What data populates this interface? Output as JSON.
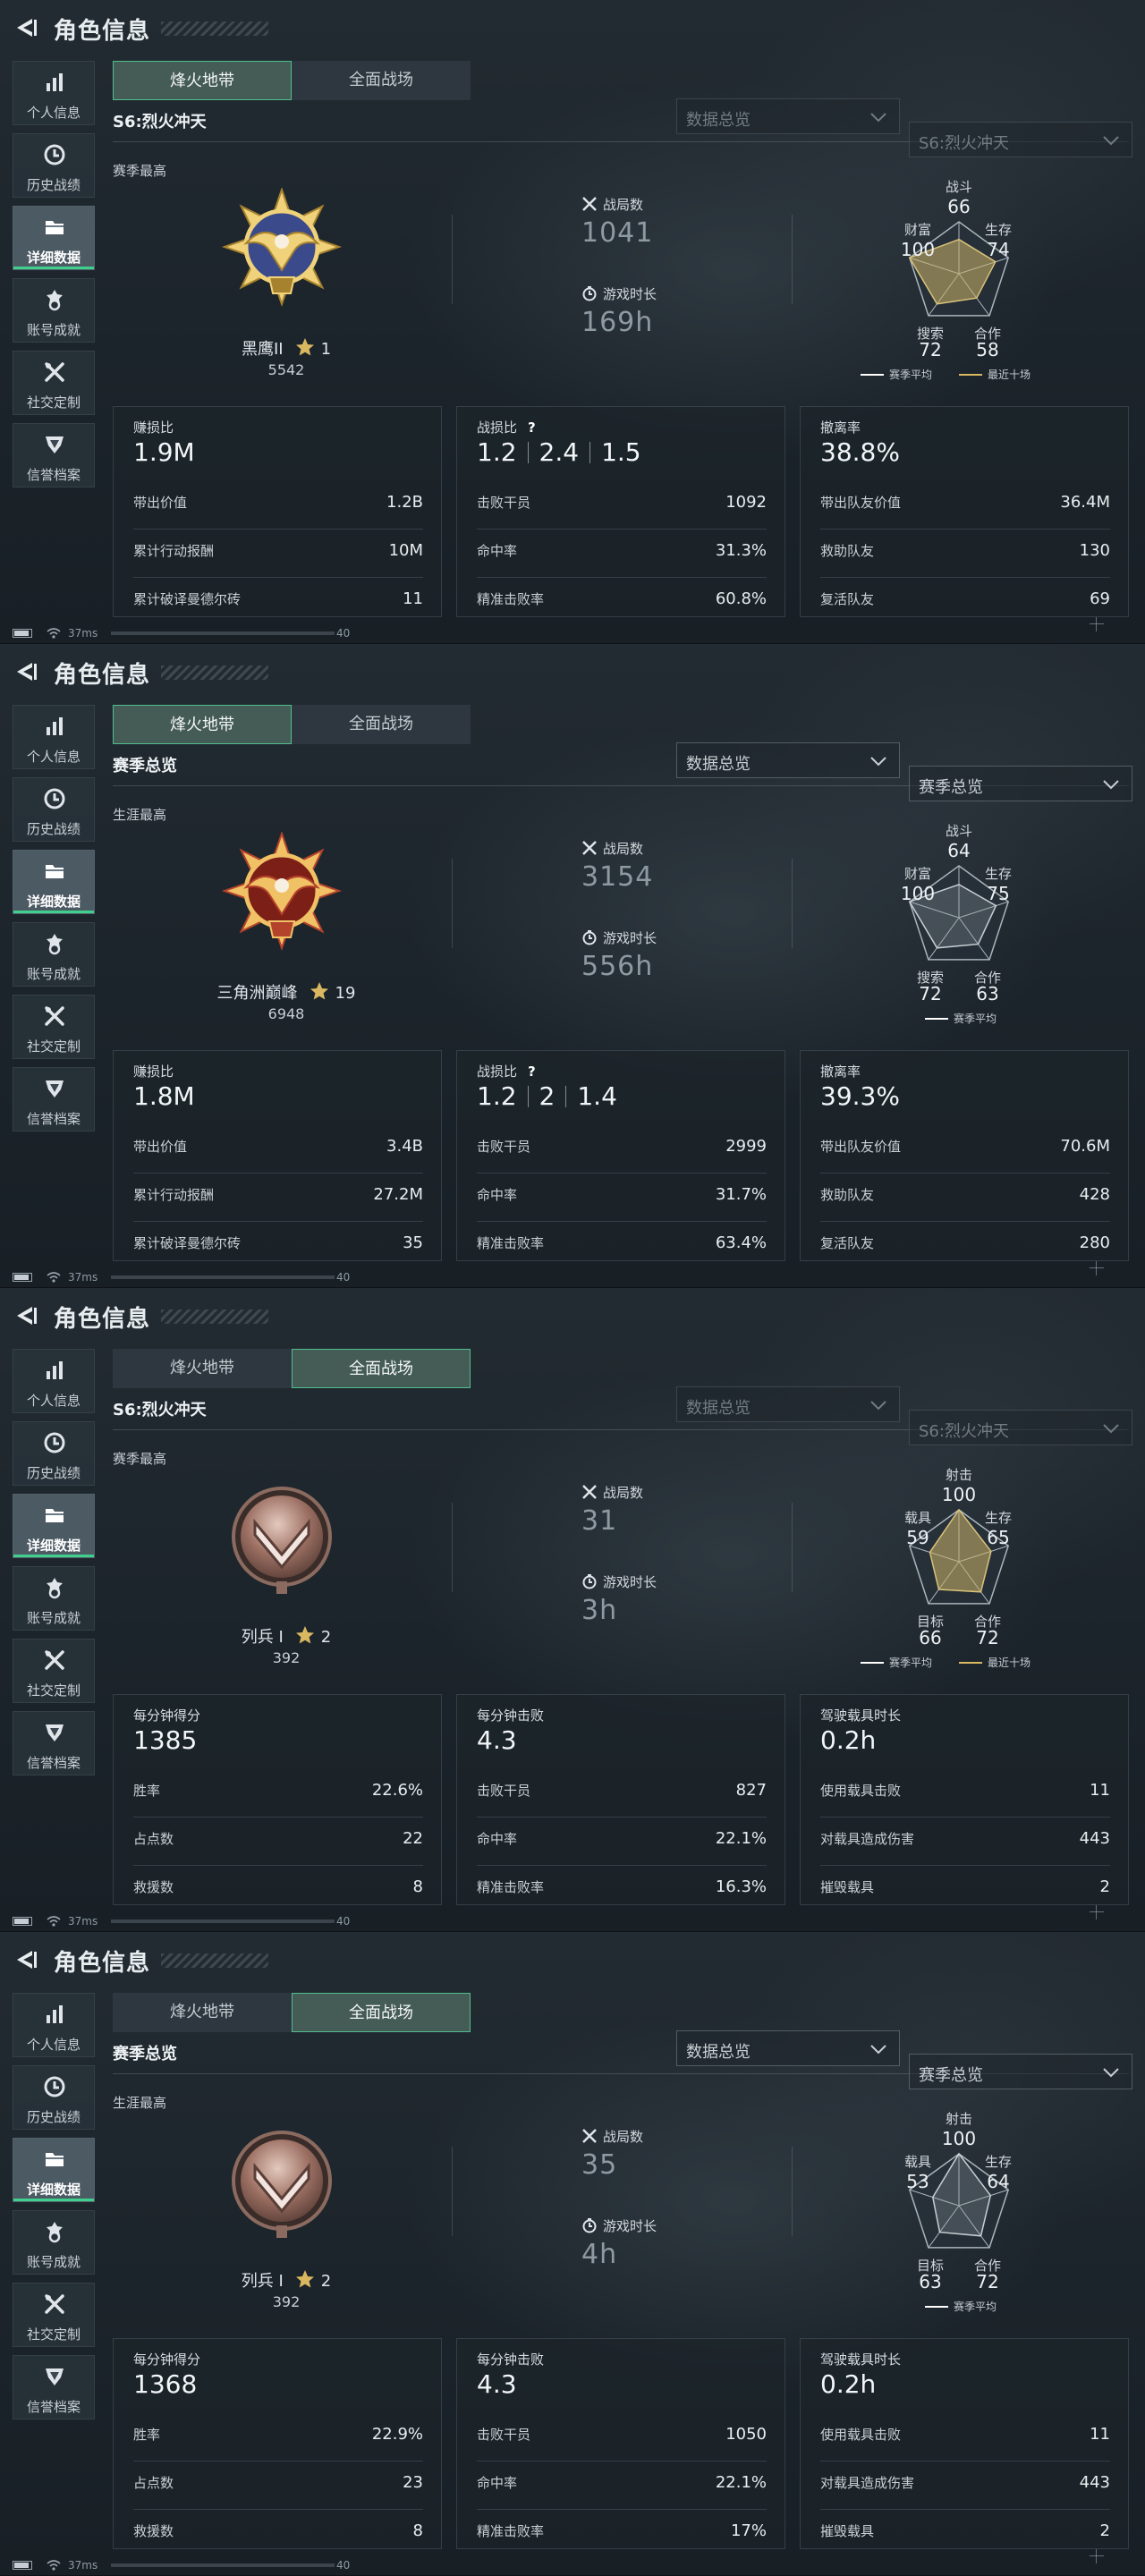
{
  "header": {
    "title": "角色信息"
  },
  "sidebar": {
    "items": [
      {
        "label": "个人信息",
        "icon": "bar-chart-icon"
      },
      {
        "label": "历史战绩",
        "icon": "clock-icon"
      },
      {
        "label": "详细数据",
        "icon": "folder-icon"
      },
      {
        "label": "账号成就",
        "icon": "medal-icon"
      },
      {
        "label": "社交定制",
        "icon": "tools-icon"
      },
      {
        "label": "信誉档案",
        "icon": "shield-icon"
      }
    ],
    "active_index": 2
  },
  "tabs": [
    "烽火地带",
    "全面战场"
  ],
  "colors": {
    "accent_green": "#3fd08e",
    "season_avg": "#ffffff",
    "recent_ten": "#d9b860",
    "radar_fill_gold": "#b9a56a"
  },
  "status": {
    "ping": "37ms",
    "count": "40"
  },
  "screens": [
    {
      "active_tab": 0,
      "subtitle": "S6:烈火冲天",
      "dropdowns": [
        "数据总览",
        "S6:烈火冲天"
      ],
      "dropdowns_dimmed": true,
      "best_label": "赛季最高",
      "rank": {
        "name": "黑鹰II",
        "stars": "1",
        "points": "5542",
        "medal": "gold-eagle"
      },
      "matches": {
        "label": "战局数",
        "value": "1041"
      },
      "playtime": {
        "label": "游戏时长",
        "value": "169h"
      },
      "radar": {
        "labels": [
          "战斗",
          "生存",
          "合作",
          "搜索",
          "财富"
        ],
        "values": [
          66,
          74,
          58,
          72,
          100
        ],
        "style": "gold"
      },
      "legend": [
        "赛季平均",
        "最近十场"
      ],
      "cards": [
        {
          "title": "赚损比",
          "main": [
            "1.9M"
          ],
          "help": "",
          "rows": [
            {
              "k": "带出价值",
              "v": "1.2B"
            },
            {
              "k": "累计行动报酬",
              "v": "10M"
            },
            {
              "k": "累计破译曼德尔砖",
              "v": "11"
            }
          ]
        },
        {
          "title": "战损比",
          "main": [
            "1.2",
            "2.4",
            "1.5"
          ],
          "help": "?",
          "rows": [
            {
              "k": "击败干员",
              "v": "1092"
            },
            {
              "k": "命中率",
              "v": "31.3%"
            },
            {
              "k": "精准击败率",
              "v": "60.8%"
            }
          ]
        },
        {
          "title": "撤离率",
          "main": [
            "38.8%"
          ],
          "help": "",
          "rows": [
            {
              "k": "带出队友价值",
              "v": "36.4M"
            },
            {
              "k": "救助队友",
              "v": "130"
            },
            {
              "k": "复活队友",
              "v": "69"
            }
          ]
        }
      ]
    },
    {
      "active_tab": 0,
      "subtitle": "赛季总览",
      "dropdowns": [
        "数据总览",
        "赛季总览"
      ],
      "dropdowns_dimmed": false,
      "best_label": "生涯最高",
      "rank": {
        "name": "三角洲巅峰",
        "stars": "19",
        "points": "6948",
        "medal": "red-eagle"
      },
      "matches": {
        "label": "战局数",
        "value": "3154"
      },
      "playtime": {
        "label": "游戏时长",
        "value": "556h"
      },
      "radar": {
        "labels": [
          "战斗",
          "生存",
          "合作",
          "搜索",
          "财富"
        ],
        "values": [
          64,
          75,
          63,
          72,
          100
        ],
        "style": "gray"
      },
      "legend": [
        "赛季平均"
      ],
      "cards": [
        {
          "title": "赚损比",
          "main": [
            "1.8M"
          ],
          "help": "",
          "rows": [
            {
              "k": "带出价值",
              "v": "3.4B"
            },
            {
              "k": "累计行动报酬",
              "v": "27.2M"
            },
            {
              "k": "累计破译曼德尔砖",
              "v": "35"
            }
          ]
        },
        {
          "title": "战损比",
          "main": [
            "1.2",
            "2",
            "1.4"
          ],
          "help": "?",
          "rows": [
            {
              "k": "击败干员",
              "v": "2999"
            },
            {
              "k": "命中率",
              "v": "31.7%"
            },
            {
              "k": "精准击败率",
              "v": "63.4%"
            }
          ]
        },
        {
          "title": "撤离率",
          "main": [
            "39.3%"
          ],
          "help": "",
          "rows": [
            {
              "k": "带出队友价值",
              "v": "70.6M"
            },
            {
              "k": "救助队友",
              "v": "428"
            },
            {
              "k": "复活队友",
              "v": "280"
            }
          ]
        }
      ]
    },
    {
      "active_tab": 1,
      "subtitle": "S6:烈火冲天",
      "dropdowns": [
        "数据总览",
        "S6:烈火冲天"
      ],
      "dropdowns_dimmed": true,
      "best_label": "赛季最高",
      "rank": {
        "name": "列兵 I",
        "stars": "2",
        "points": "392",
        "medal": "bronze-chevron"
      },
      "matches": {
        "label": "战局数",
        "value": "31"
      },
      "playtime": {
        "label": "游戏时长",
        "value": "3h"
      },
      "radar": {
        "labels": [
          "射击",
          "生存",
          "合作",
          "目标",
          "载具"
        ],
        "values": [
          100,
          65,
          72,
          66,
          59
        ],
        "style": "gold"
      },
      "legend": [
        "赛季平均",
        "最近十场"
      ],
      "cards": [
        {
          "title": "每分钟得分",
          "main": [
            "1385"
          ],
          "help": "",
          "rows": [
            {
              "k": "胜率",
              "v": "22.6%"
            },
            {
              "k": "占点数",
              "v": "22"
            },
            {
              "k": "救援数",
              "v": "8"
            }
          ]
        },
        {
          "title": "每分钟击败",
          "main": [
            "4.3"
          ],
          "help": "",
          "rows": [
            {
              "k": "击败干员",
              "v": "827"
            },
            {
              "k": "命中率",
              "v": "22.1%"
            },
            {
              "k": "精准击败率",
              "v": "16.3%"
            }
          ]
        },
        {
          "title": "驾驶载具时长",
          "main": [
            "0.2h"
          ],
          "help": "",
          "rows": [
            {
              "k": "使用载具击败",
              "v": "11"
            },
            {
              "k": "对载具造成伤害",
              "v": "443"
            },
            {
              "k": "摧毁载具",
              "v": "2"
            }
          ]
        }
      ]
    },
    {
      "active_tab": 1,
      "subtitle": "赛季总览",
      "dropdowns": [
        "数据总览",
        "赛季总览"
      ],
      "dropdowns_dimmed": false,
      "best_label": "生涯最高",
      "rank": {
        "name": "列兵 I",
        "stars": "2",
        "points": "392",
        "medal": "bronze-chevron"
      },
      "matches": {
        "label": "战局数",
        "value": "35"
      },
      "playtime": {
        "label": "游戏时长",
        "value": "4h"
      },
      "radar": {
        "labels": [
          "射击",
          "生存",
          "合作",
          "目标",
          "载具"
        ],
        "values": [
          100,
          64,
          72,
          63,
          53
        ],
        "style": "gray"
      },
      "legend": [
        "赛季平均"
      ],
      "cards": [
        {
          "title": "每分钟得分",
          "main": [
            "1368"
          ],
          "help": "",
          "rows": [
            {
              "k": "胜率",
              "v": "22.9%"
            },
            {
              "k": "占点数",
              "v": "23"
            },
            {
              "k": "救援数",
              "v": "8"
            }
          ]
        },
        {
          "title": "每分钟击败",
          "main": [
            "4.3"
          ],
          "help": "",
          "rows": [
            {
              "k": "击败干员",
              "v": "1050"
            },
            {
              "k": "命中率",
              "v": "22.1%"
            },
            {
              "k": "精准击败率",
              "v": "17%"
            }
          ]
        },
        {
          "title": "驾驶载具时长",
          "main": [
            "0.2h"
          ],
          "help": "",
          "rows": [
            {
              "k": "使用载具击败",
              "v": "11"
            },
            {
              "k": "对载具造成伤害",
              "v": "443"
            },
            {
              "k": "摧毁载具",
              "v": "2"
            }
          ]
        }
      ]
    }
  ]
}
